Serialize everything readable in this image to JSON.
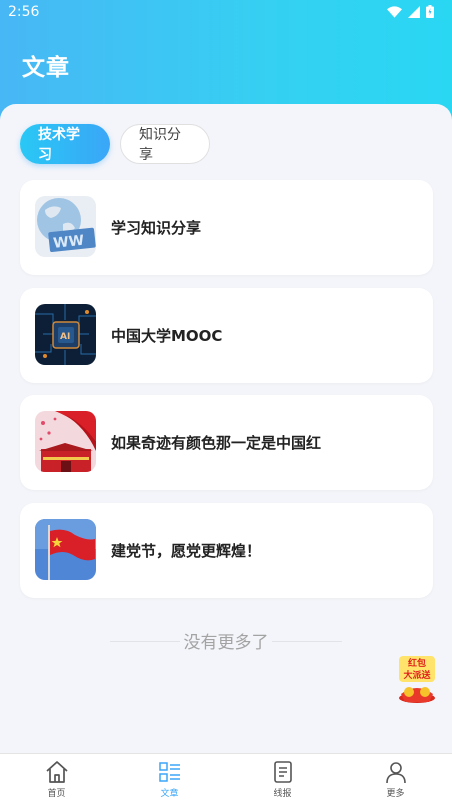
{
  "status": {
    "time": "2:56"
  },
  "header": {
    "title": "文章"
  },
  "tabs": [
    {
      "label": "技术学习",
      "active": true
    },
    {
      "label": "知识分享",
      "active": false
    }
  ],
  "articles": [
    {
      "title": "学习知识分享",
      "thumb": "www-globe"
    },
    {
      "title": "中国大学MOOC",
      "thumb": "ai-chip"
    },
    {
      "title": "如果奇迹有颜色那一定是中国红",
      "thumb": "tiananmen"
    },
    {
      "title": "建党节，愿党更辉煌！",
      "thumb": "red-flag"
    }
  ],
  "list_footer": "没有更多了",
  "promo": {
    "line1": "红包",
    "line2": "大派送"
  },
  "tabbar": [
    {
      "label": "首页",
      "icon": "home-icon",
      "active": false
    },
    {
      "label": "文章",
      "icon": "list-icon",
      "active": true
    },
    {
      "label": "线报",
      "icon": "document-icon",
      "active": false
    },
    {
      "label": "更多",
      "icon": "user-icon",
      "active": false
    }
  ],
  "colors": {
    "accent": "#3aa6f7",
    "header_start": "#48b7f5",
    "header_end": "#29d7f3"
  }
}
